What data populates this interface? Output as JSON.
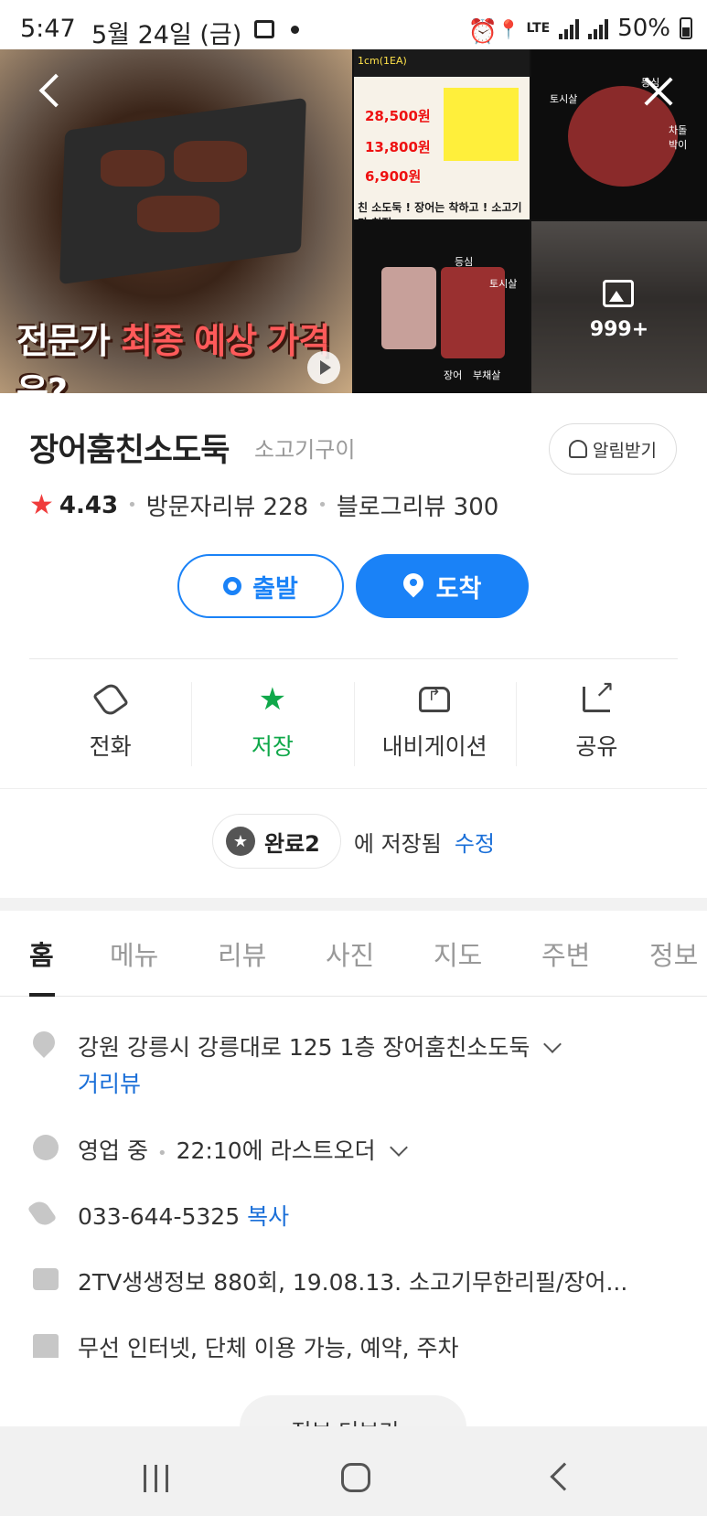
{
  "status_bar": {
    "time": "5:47",
    "date": "5월 24일 (금)",
    "network": "LTE",
    "battery": "50%"
  },
  "photos": {
    "main_caption_prefix": "전문가 ",
    "main_caption_highlight": "최종 예상 가격",
    "main_caption_suffix": "은?",
    "menu_header": "1cm(1EA)",
    "menu_price_1": "28,500원",
    "menu_price_2": "13,800원",
    "menu_price_3": "6,900원",
    "menu_banner": "친 소도둑 ! 장어는 착하고 ! 소고기가 친절",
    "cuts_label_1": "토시살",
    "cuts_label_2": "등심",
    "cuts_label_3": "차돌박이",
    "plate_label_1": "등심",
    "plate_label_2": "토시살",
    "plate_label_3": "장어",
    "plate_label_4": "부채살",
    "more_count": "999+"
  },
  "place": {
    "name": "장어훔친소도둑",
    "category": "소고기구이",
    "alarm_label": "알림받기",
    "rating": "4.43",
    "visitor_reviews": "방문자리뷰 228",
    "blog_reviews": "블로그리뷰 300"
  },
  "route": {
    "start_label": "출발",
    "arrive_label": "도착"
  },
  "actions": [
    {
      "label": "전화"
    },
    {
      "label": "저장"
    },
    {
      "label": "내비게이션"
    },
    {
      "label": "공유"
    }
  ],
  "saved": {
    "list_name": "완료2",
    "saved_text": "에 저장됨",
    "edit_label": "수정"
  },
  "tabs": [
    "홈",
    "메뉴",
    "리뷰",
    "사진",
    "지도",
    "주변",
    "정보"
  ],
  "info": {
    "address": "강원 강릉시 강릉대로 125 1층 장어훔친소도둑",
    "street_view": "거리뷰",
    "hours_status": "영업 중",
    "hours_detail": "22:10에 라스트오더",
    "phone": "033-644-5325",
    "copy_label": "복사",
    "tv": "2TV생생정보 880회, 19.08.13. 소고기무한리필/장어...",
    "amenities": "무선 인터넷, 단체 이용 가능, 예약, 주차",
    "more_label": "정보 더보기 ›"
  },
  "colors": {
    "accent": "#1a82f7",
    "saved_green": "#10a84a",
    "rating_star": "#f03c3c",
    "link": "#1a6fd8"
  }
}
